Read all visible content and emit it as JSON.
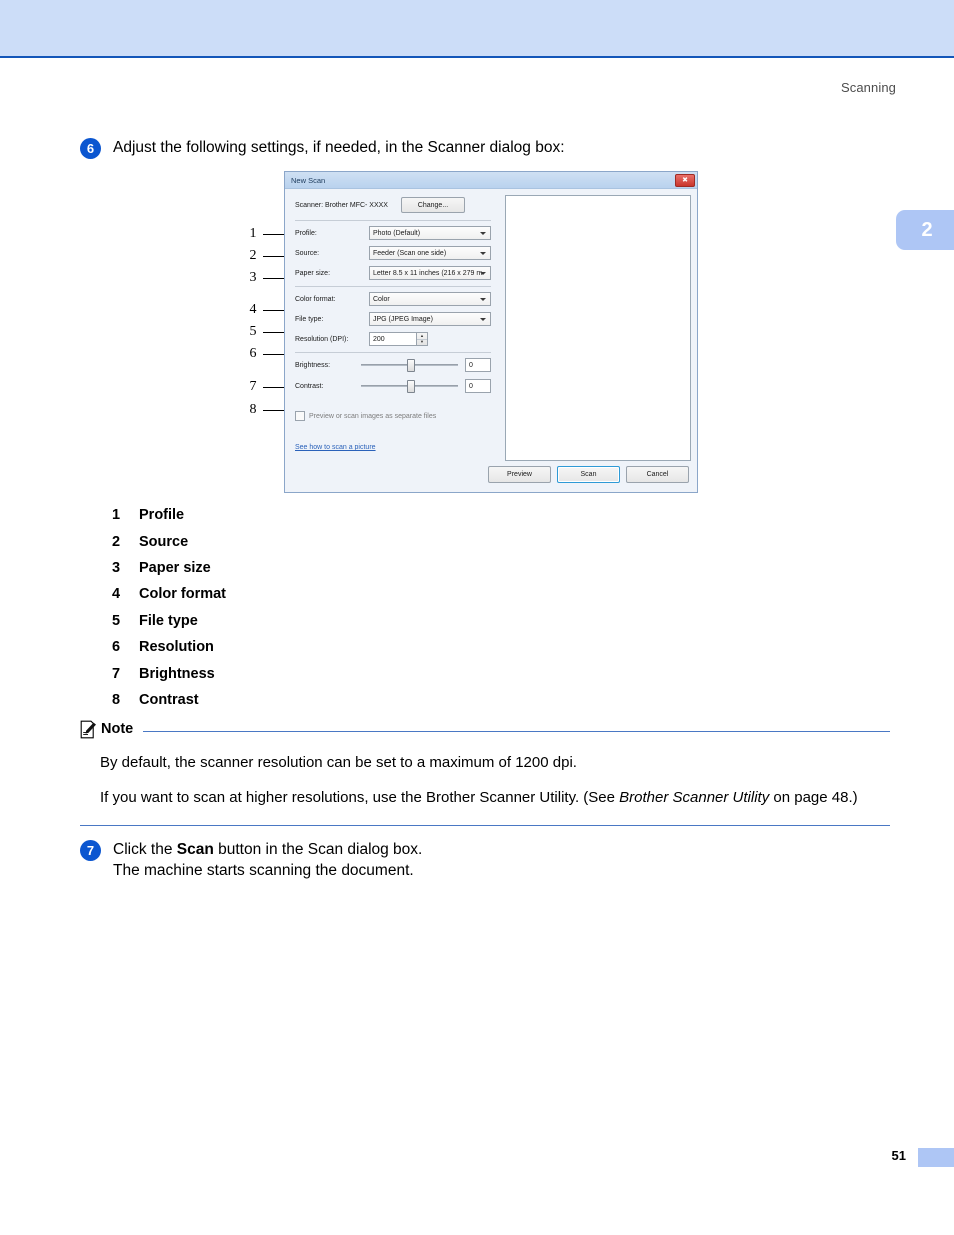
{
  "header": {
    "running_title": "Scanning",
    "chapter_tab": "2",
    "page_number": "51"
  },
  "steps": [
    {
      "number": "6",
      "text": "Adjust the following settings, if needed, in the Scanner dialog box:"
    },
    {
      "number": "7",
      "text_line1_before": "Click the ",
      "text_line1_bold": "Scan",
      "text_line1_after": " button in the Scan dialog box.",
      "text_line2": "The machine starts scanning the document."
    }
  ],
  "legend": {
    "items": [
      {
        "num": "1",
        "label": "Profile"
      },
      {
        "num": "2",
        "label": "Source"
      },
      {
        "num": "3",
        "label": "Paper size"
      },
      {
        "num": "4",
        "label": "Color format"
      },
      {
        "num": "5",
        "label": "File type"
      },
      {
        "num": "6",
        "label": "Resolution"
      },
      {
        "num": "7",
        "label": "Brightness"
      },
      {
        "num": "8",
        "label": "Contrast"
      }
    ]
  },
  "note": {
    "title": "Note",
    "paragraph1": "By default, the scanner resolution can be set to a maximum of 1200 dpi.",
    "paragraph2_before": "If you want to scan at higher resolutions, use the Brother Scanner Utility. (See ",
    "paragraph2_italic": "Brother Scanner Utility",
    "paragraph2_after": " on page 48.)"
  },
  "dialog": {
    "title": "New Scan",
    "close_label": "✖",
    "scanner_label": "Scanner: Brother MFC- XXXX",
    "change_button": "Change...",
    "fields": [
      {
        "label": "Profile:",
        "value": "Photo (Default)"
      },
      {
        "label": "Source:",
        "value": "Feeder (Scan one side)"
      },
      {
        "label": "Paper size:",
        "value": "Letter 8.5 x 11 inches (216 x 279 m"
      },
      {
        "label": "Color format:",
        "value": "Color"
      },
      {
        "label": "File type:",
        "value": "JPG (JPEG Image)"
      }
    ],
    "resolution": {
      "label": "Resolution (DPI):",
      "value": "200"
    },
    "sliders": [
      {
        "label": "Brightness:",
        "value": "0"
      },
      {
        "label": "Contrast:",
        "value": "0"
      }
    ],
    "checkbox_label": "Preview or scan images as separate files",
    "help_link": "See how to scan a picture",
    "buttons": {
      "preview": "Preview",
      "scan": "Scan",
      "cancel": "Cancel"
    },
    "callouts": [
      "1",
      "2",
      "3",
      "4",
      "5",
      "6",
      "7",
      "8"
    ]
  },
  "colors": {
    "banner": "#ccddf8",
    "banner_border": "#1356b9",
    "step_bullet": "#0b56d0",
    "tab": "#aec6f5",
    "note_rule": "#4a78c4",
    "link": "#2b62ba",
    "default_button_focus": "#2e9ad6"
  }
}
